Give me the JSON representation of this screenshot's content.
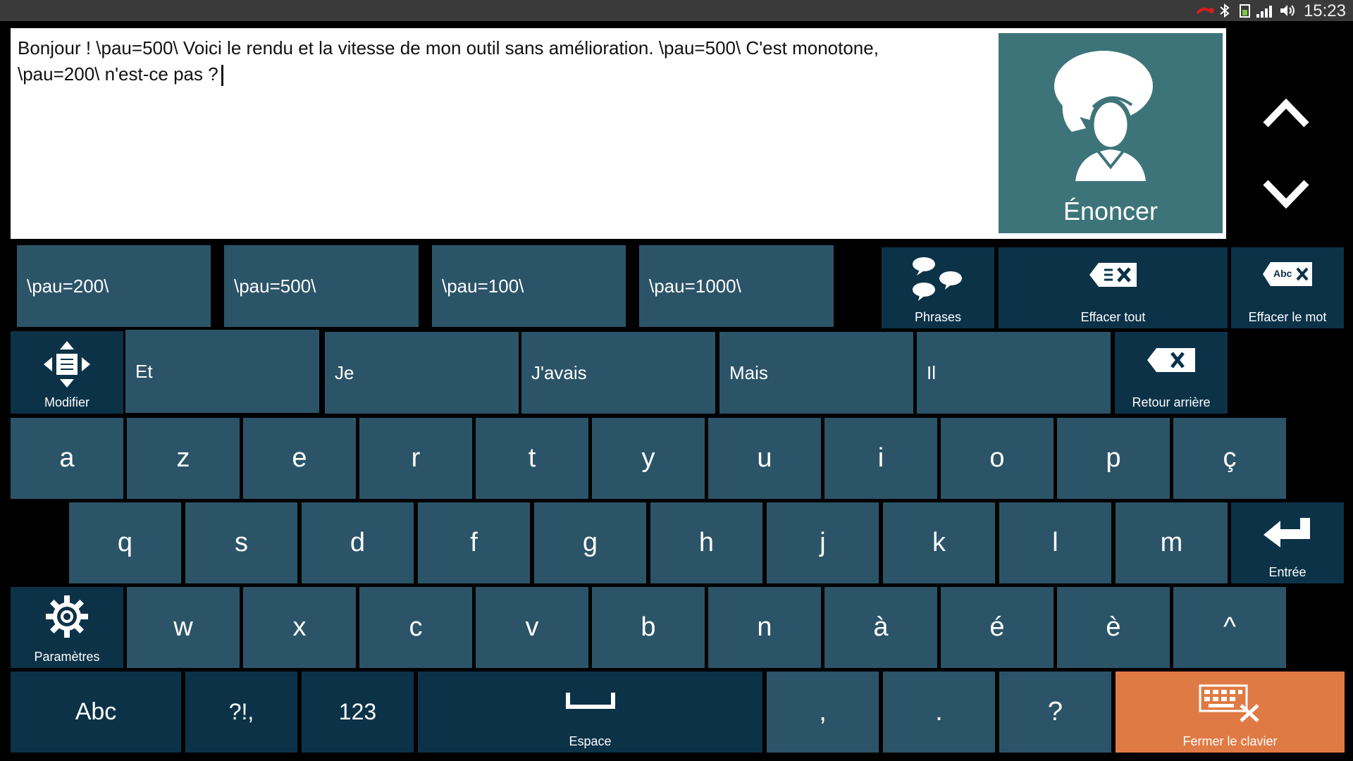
{
  "status_bar": {
    "time": "15:23"
  },
  "editor": {
    "line1": "Bonjour !  \\pau=500\\ Voici le rendu et la vitesse de mon outil sans amélioration.  \\pau=500\\ C'est monotone,",
    "line2": "\\pau=200\\ n'est-ce pas ?"
  },
  "speak_button": {
    "label": "Énoncer",
    "icon": "speaking-head-icon"
  },
  "snippets": [
    "\\pau=200\\",
    "\\pau=500\\",
    "\\pau=100\\",
    "\\pau=1000\\"
  ],
  "actions": {
    "phrases": "Phrases",
    "clear_all": "Effacer tout",
    "clear_word": "Effacer le mot",
    "clear_word_icon_text": "Abc",
    "backspace": "Retour arrière",
    "modify": "Modifier",
    "enter": "Entrée",
    "settings": "Paramètres",
    "space": "Espace",
    "close_keyboard": "Fermer le clavier"
  },
  "predictions": [
    "Et",
    "Je",
    "J'avais",
    "Mais",
    "Il"
  ],
  "keys": {
    "row1": [
      "a",
      "z",
      "e",
      "r",
      "t",
      "y",
      "u",
      "i",
      "o",
      "p",
      "ç"
    ],
    "row2": [
      "q",
      "s",
      "d",
      "f",
      "g",
      "h",
      "j",
      "k",
      "l",
      "m"
    ],
    "row3": [
      "w",
      "x",
      "c",
      "v",
      "b",
      "n",
      "à",
      "é",
      "è",
      "^"
    ],
    "row4": [
      "Abc",
      "?!,",
      "123"
    ],
    "punct": [
      ",",
      ".",
      "?"
    ]
  },
  "colors": {
    "key": "#2c5468",
    "key_dark": "#0c3248",
    "speak": "#3d7479",
    "close": "#e07a45",
    "status_bar": "#3a3a3a"
  }
}
